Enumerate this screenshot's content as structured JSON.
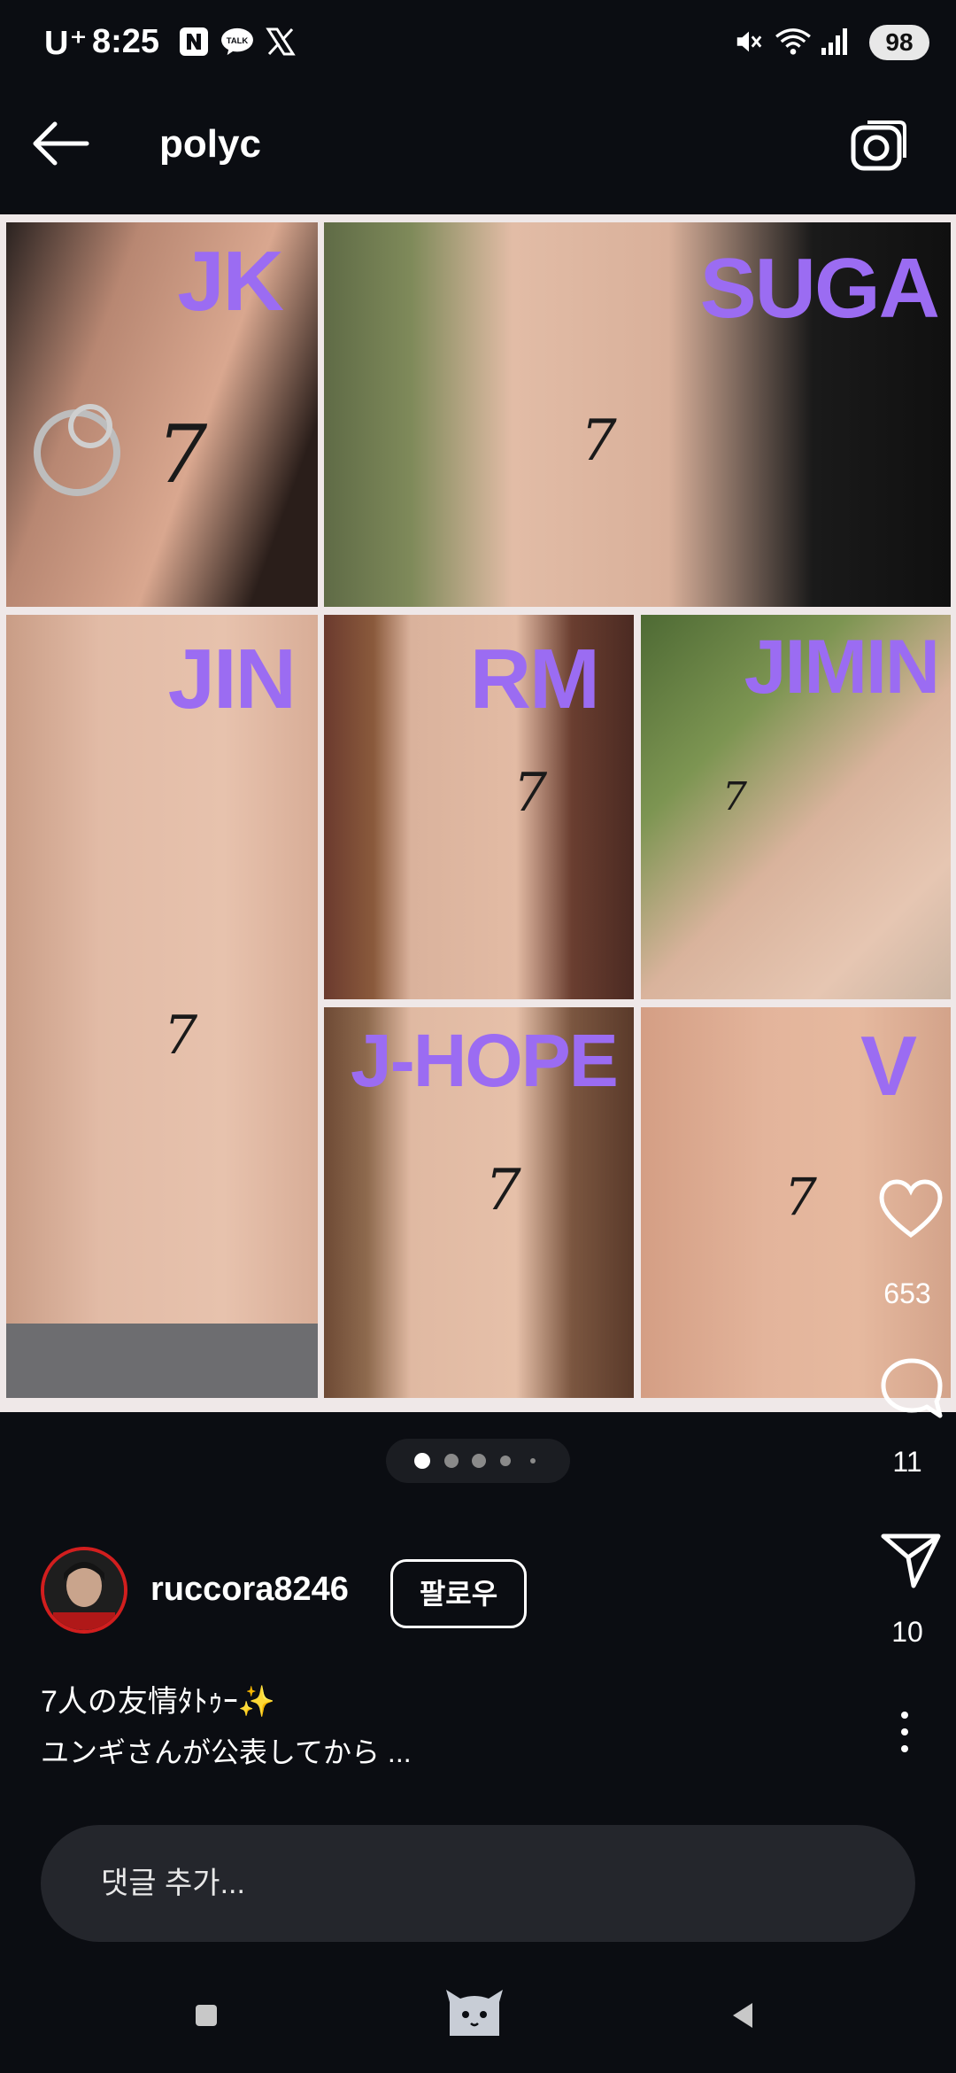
{
  "status_bar": {
    "carrier": "U⁺",
    "time": "8:25",
    "battery": "98",
    "notification_icons": [
      "naver-icon",
      "kakaotalk-icon",
      "x-icon"
    ],
    "system_icons": [
      "mute-icon",
      "wifi-icon",
      "signal-icon"
    ]
  },
  "header": {
    "title": "polyc",
    "back_icon": "arrow-left-icon",
    "camera_icon": "camera-icon"
  },
  "grid": {
    "tiles": [
      {
        "label": "JK",
        "mark": "7"
      },
      {
        "label": "SUGA",
        "mark": "7"
      },
      {
        "label": "JIN",
        "mark": "7"
      },
      {
        "label": "RM",
        "mark": "7"
      },
      {
        "label": "JIMIN",
        "mark": "7"
      },
      {
        "label": "J-HOPE",
        "mark": "7"
      },
      {
        "label": "V",
        "mark": "7"
      }
    ],
    "label_color": "#9b6cf2"
  },
  "actions": {
    "likes": "653",
    "comments": "11",
    "shares": "10"
  },
  "carousel": {
    "total_dots": 5,
    "active_index": 0
  },
  "post": {
    "username": "ruccora8246",
    "follow_label": "팔로우",
    "caption_line1": "7人の友情ﾀﾄｩｰ✨",
    "caption_line2": "ユンギさんが公表してから ..."
  },
  "comment_input": {
    "placeholder": "댓글 추가..."
  },
  "colors": {
    "background": "#0b0d12",
    "accent_purple": "#9b6cf2",
    "avatar_ring": "#d21e1e"
  }
}
